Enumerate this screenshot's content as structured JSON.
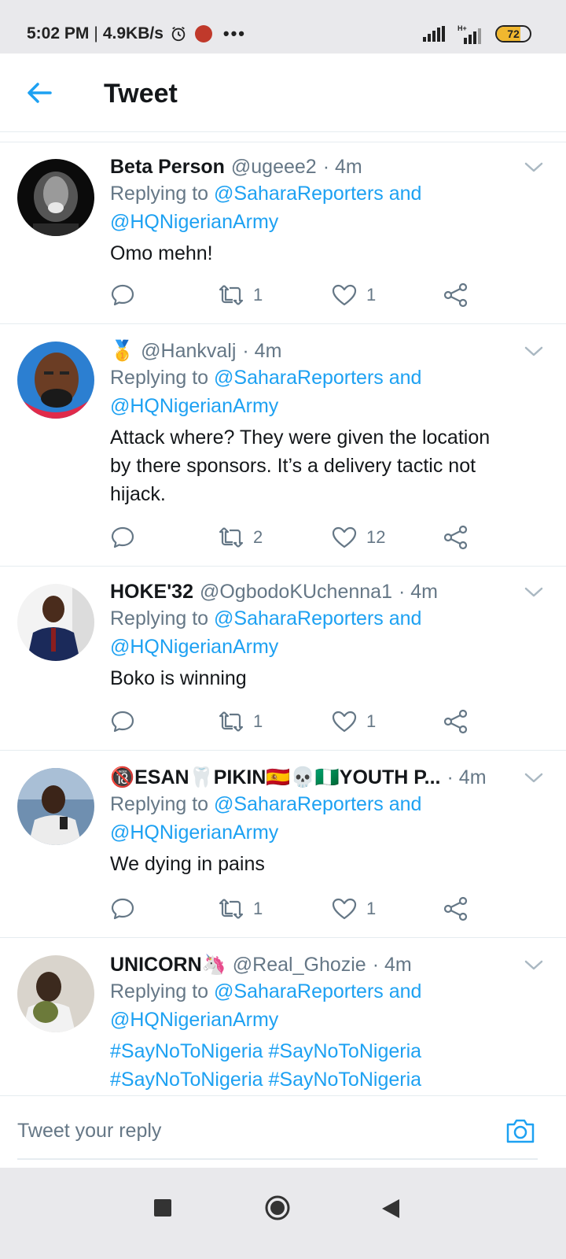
{
  "status_bar": {
    "time": "5:02 PM",
    "speed": "4.9KB/s",
    "network": "H+",
    "battery": 72,
    "battery_color": "#f0b72f"
  },
  "header": {
    "title": "Tweet"
  },
  "reply_label": "Replying to",
  "tweets": [
    {
      "name": "Beta Person",
      "handle": "@ugeee2",
      "time": "· 4m",
      "mention1": "@SaharaReporters and",
      "mention2": "@HQNigerianArmy",
      "text": "Omo mehn!",
      "retweets": "1",
      "likes": "1"
    },
    {
      "name": "🥇",
      "handle": "@Hankvalj",
      "time": "· 4m",
      "mention1": "@SaharaReporters and",
      "mention2": "@HQNigerianArmy",
      "text_lines": [
        "Attack where? They were given the location",
        "by there sponsors.  It’s a delivery tactic not",
        "hijack."
      ],
      "retweets": "2",
      "likes": "12"
    },
    {
      "name": "HOKE'32",
      "handle": "@OgbodoKUchenna1",
      "time": "· 4m",
      "mention1": "@SaharaReporters and",
      "mention2": "@HQNigerianArmy",
      "text": "Boko is winning",
      "retweets": "1",
      "likes": "1"
    },
    {
      "name": "🔞ESAN🦷PIKIN🇪🇸💀🇳🇬YOUTH P...",
      "handle": "",
      "time": "· 4m",
      "mention1": "@SaharaReporters and",
      "mention2": "@HQNigerianArmy",
      "text": "We dying in pains",
      "retweets": "1",
      "likes": "1"
    },
    {
      "name": "UNICORN🦄",
      "handle": "@Real_Ghozie",
      "time": "· 4m",
      "mention1": "@SaharaReporters and",
      "mention2": "@HQNigerianArmy",
      "hashtags_line1": "#SayNoToNigeria #SayNoToNigeria",
      "hashtags_line2": "#SayNoToNigeria #SayNoToNigeria"
    }
  ],
  "composer": {
    "placeholder": "Tweet your reply"
  },
  "colors": {
    "accent": "#1da1f2",
    "secondary_text": "#657786",
    "divider": "#e6ecf0"
  },
  "icons": {
    "back": "arrow-left-icon",
    "reply": "speech-bubble-icon",
    "retweet": "retweet-icon",
    "like": "heart-icon",
    "share": "share-icon",
    "chevron": "chevron-down-icon",
    "camera": "camera-icon"
  }
}
